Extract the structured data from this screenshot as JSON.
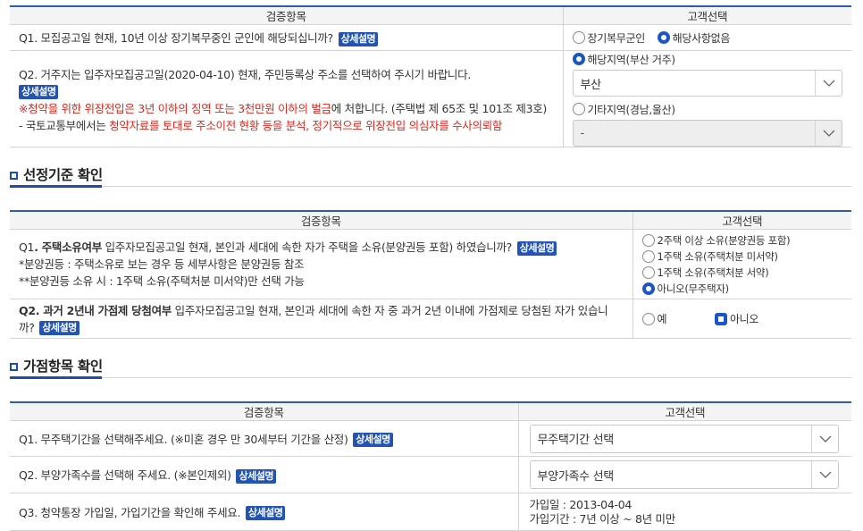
{
  "badge_label": "상세설명",
  "section1": {
    "col_item": "검증항목",
    "col_choice": "고객선택",
    "q1": {
      "text": "Q1. 모집공고일 현재, 10년 이상 장기복무중인 군인에 해당되십니까?",
      "options": [
        "장기복무군인",
        "해당사항없음"
      ]
    },
    "q2": {
      "text": "Q2. 거주지는 입주자모집공고일(2020-04-10) 현재, 주민등록상 주소를 선택하여 주시기 바랍니다.",
      "warn_pre": "※청약을 위한 위장전입은 3년 이하의 징역 또는 3천만원 이하의 벌금",
      "warn_post": "에 처합니다. (주택법 제 65조 및 101조 제3호)",
      "note_pre": "- 국토교통부에서는 ",
      "note_red": "청약자료를 토대로 주소이전 현황 등을 분석, 정기적으로 위장전입 의심자를 수사의뢰함",
      "option_local": "해당지역(부산 거주)",
      "select_local": "부산",
      "option_other": "기타지역(경남,울산)",
      "select_other": "-"
    }
  },
  "section2": {
    "title": "선정기준 확인",
    "col_item": "검증항목",
    "col_choice": "고객선택",
    "q1": {
      "prefix": "Q1",
      "bold": ". 주택소유여부",
      "text": " 입주자모집공고일 현재, 본인과 세대에 속한 자가 주택을 소유(분양권등 포함) 하였습니까?",
      "note1": "*분양권등 : 주택소유로 보는 경우 등 세부사항은 분양권등 참조",
      "note2": "**분양권등 소유 시 : 1주택 소유(주택처분 미서약)만 선택 가능",
      "options": [
        "2주택 이상 소유(분양권등 포함)",
        "1주택 소유(주택처분 미서약)",
        "1주택 소유(주택처분 서약)",
        "아니오(무주택자)"
      ]
    },
    "q2": {
      "bold": "Q2. 과거 2년내 가점제 당첨여부",
      "text": " 입주자모집공고일 현재, 본인과 세대에 속한 자 중 과거 2년 이내에 가점제로 당첨된 자가 있습니까?",
      "options": [
        "예",
        "아니오"
      ]
    }
  },
  "section3": {
    "title": "가점항목 확인",
    "col_item": "검증항목",
    "col_choice": "고객선택",
    "q1": {
      "text": "Q1. 무주택기간을 선택해주세요. (※미혼 경우 만 30세부터 기간을 산정)",
      "select": "무주택기간 선택"
    },
    "q2": {
      "text": "Q2. 부양가족수를 선택해 주세요. (※본인제외)",
      "select": "부양가족수 선택"
    },
    "q3": {
      "text": "Q3. 청약통장 가입일, 가입기간을 확인해 주세요.",
      "join_date": "가입일 : 2013-04-04",
      "join_period": "가입기간 : 7년 이상 ~ 8년 미만"
    }
  },
  "colors": {
    "accent": "#1d4fa8",
    "badge": "#2454b3",
    "radio_on": "#1a56c6",
    "warning": "#e1261c"
  }
}
